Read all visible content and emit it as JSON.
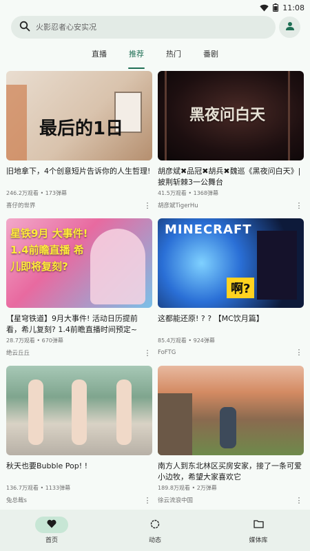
{
  "status_bar": {
    "time": "11:08"
  },
  "search": {
    "placeholder": "火影忍者心安实况"
  },
  "tabs": [
    {
      "label": "直播",
      "active": false
    },
    {
      "label": "推荐",
      "active": true
    },
    {
      "label": "热门",
      "active": false
    },
    {
      "label": "番剧",
      "active": false
    }
  ],
  "videos": [
    {
      "title": "旧地拿下，4个创意短片告诉你的人生哲理!",
      "stats": "246.2万观看 • 173弹幕",
      "author": "喜仔的世界",
      "thumb_text": "最后的1日"
    },
    {
      "title": "胡彦斌✖品冠✖胡兵✖魏巡《黑夜问白天》| 披荆斩棘3一公舞台",
      "stats": "41.5万观看 • 1368弹幕",
      "author": "胡彦斌TigerHu",
      "thumb_text": "黑夜问白天"
    },
    {
      "title": "【星穹铁道】9月大事件! 活动日历提前看，希儿复刻? 1.4前瞻直播时间预定~",
      "stats": "28.7万观看 • 670弹幕",
      "author": "绝云丘丘",
      "thumb_text": "星铁9月 大事件! 1.4前瞻直播 希儿即将复刻?"
    },
    {
      "title": "这都能还原! ? ? 【MC饮月篇】",
      "stats": "85.4万观看 • 924弹幕",
      "author": "FoFTG",
      "thumb_text": "啊?"
    },
    {
      "title": "秋天也要Bubble Pop! !",
      "stats": "136.7万观看 • 1133弹幕",
      "author": "兔总裁s",
      "thumb_text": ""
    },
    {
      "title": "南方人到东北林区买房安家，接了一条可爱小边牧，希望大家喜欢它",
      "stats": "189.8万观看 • 2万弹幕",
      "author": "徐云流浪中国",
      "thumb_text": ""
    }
  ],
  "bottom_nav": [
    {
      "label": "首页",
      "icon": "heart-icon",
      "active": true
    },
    {
      "label": "动态",
      "icon": "circle-icon",
      "active": false
    },
    {
      "label": "媒体库",
      "icon": "folder-icon",
      "active": false
    }
  ],
  "colors": {
    "accent": "#1f6f55",
    "background": "#f6faf7",
    "nav_active": "#c7e6d5"
  }
}
